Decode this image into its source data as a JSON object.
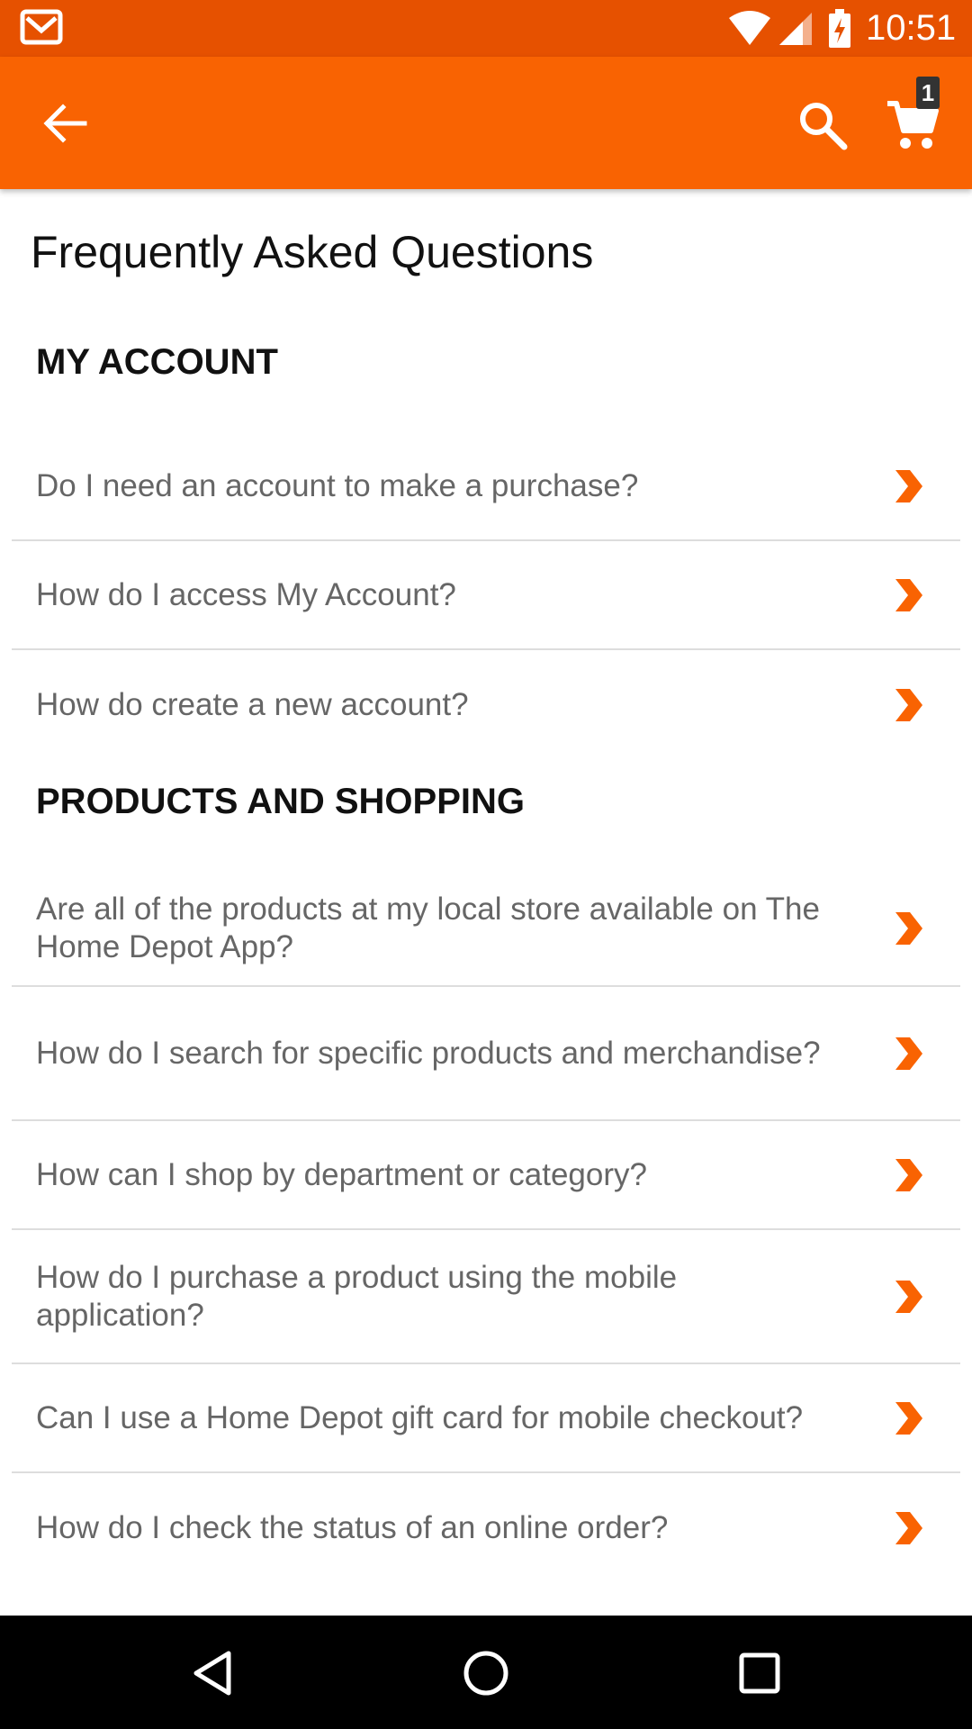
{
  "status_bar": {
    "time": "10:51",
    "icons": [
      "gmail-icon",
      "wifi-icon",
      "signal-icon",
      "battery-charging-icon"
    ]
  },
  "app_bar": {
    "cart_count": "1",
    "icons": [
      "back-arrow-icon",
      "search-icon",
      "cart-icon"
    ],
    "color": "#f96302"
  },
  "page": {
    "title": "Frequently Asked Questions"
  },
  "sections": [
    {
      "title": "MY ACCOUNT",
      "questions": [
        "Do I need an account to make a purchase?",
        "How do I access My Account?",
        "How do create a new account?"
      ]
    },
    {
      "title": "PRODUCTS AND SHOPPING",
      "questions": [
        "Are all of the products at my local store available on The Home Depot App?",
        "How do I search for specific products and merchandise?",
        "How can I shop by department or category?",
        "How do I purchase a product using the mobile application?",
        "Can I use a Home Depot gift card for mobile checkout?",
        "How do I check the status of an online order?"
      ]
    }
  ],
  "nav_bar": {
    "icons": [
      "back-triangle-icon",
      "home-circle-icon",
      "recents-square-icon"
    ]
  },
  "colors": {
    "accent": "#f96302",
    "status_bar": "#e65100",
    "chevron": "#f96302"
  }
}
